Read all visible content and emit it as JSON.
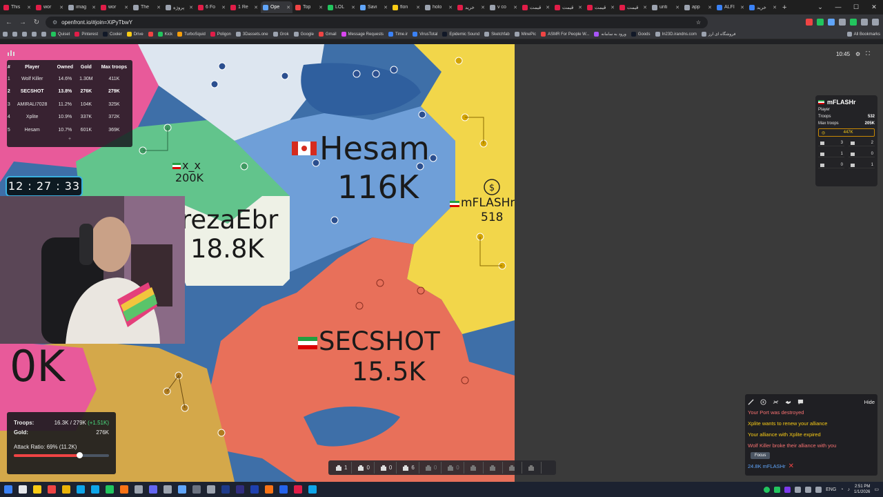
{
  "browser": {
    "tabs": [
      {
        "label": "This",
        "color": "#e11d48"
      },
      {
        "label": "wor",
        "color": "#e11d48"
      },
      {
        "label": "imag",
        "color": "#9ca3af"
      },
      {
        "label": "wor",
        "color": "#e11d48"
      },
      {
        "label": "The",
        "color": "#9ca3af"
      },
      {
        "label": "پروژه",
        "color": "#9ca3af"
      },
      {
        "label": "6 Fo",
        "color": "#e11d48"
      },
      {
        "label": "1 Re",
        "color": "#e11d48"
      },
      {
        "label": "Ope",
        "color": "#60a5fa",
        "active": true
      },
      {
        "label": "Top",
        "color": "#ef4444"
      },
      {
        "label": "LOL",
        "color": "#22c55e"
      },
      {
        "label": "Savi",
        "color": "#60a5fa"
      },
      {
        "label": "flon",
        "color": "#facc15"
      },
      {
        "label": "holo",
        "color": "#9ca3af"
      },
      {
        "label": "خرید",
        "color": "#e11d48"
      },
      {
        "label": "v co",
        "color": "#9ca3af"
      },
      {
        "label": "قیمت",
        "color": "#e11d48"
      },
      {
        "label": "قیمت",
        "color": "#e11d48"
      },
      {
        "label": "قیمت",
        "color": "#e11d48"
      },
      {
        "label": "قیمت",
        "color": "#e11d48"
      },
      {
        "label": "unti",
        "color": "#9ca3af"
      },
      {
        "label": "app",
        "color": "#9ca3af"
      },
      {
        "label": "ALFI",
        "color": "#3b82f6"
      },
      {
        "label": "خرید",
        "color": "#3b82f6"
      }
    ],
    "url": "openfront.io/#join=XiPyTbwY",
    "bookmarks": [
      {
        "label": "",
        "color": "#9ca3af"
      },
      {
        "label": "",
        "color": "#9ca3af"
      },
      {
        "label": "",
        "color": "#9ca3af"
      },
      {
        "label": "",
        "color": "#9ca3af"
      },
      {
        "label": "",
        "color": "#9ca3af"
      },
      {
        "label": "Quiset",
        "color": "#22c55e"
      },
      {
        "label": "Pinterest",
        "color": "#e11d48"
      },
      {
        "label": "Cooler",
        "color": "#111827"
      },
      {
        "label": "Drive",
        "color": "#facc15"
      },
      {
        "label": "",
        "color": "#ef4444"
      },
      {
        "label": "Kick",
        "color": "#22c55e"
      },
      {
        "label": "TurboSquid",
        "color": "#f59e0b"
      },
      {
        "label": "Poligon",
        "color": "#e11d48"
      },
      {
        "label": "3Dassets.one",
        "color": "#9ca3af"
      },
      {
        "label": "Grok",
        "color": "#9ca3af"
      },
      {
        "label": "Google",
        "color": "#9ca3af"
      },
      {
        "label": "Gmail",
        "color": "#ef4444"
      },
      {
        "label": "Message Requests",
        "color": "#d946ef"
      },
      {
        "label": "Time.ir",
        "color": "#3b82f6"
      },
      {
        "label": "VirusTotal",
        "color": "#3b82f6"
      },
      {
        "label": "Epidemic Sound",
        "color": "#111827"
      },
      {
        "label": "Sketchfab",
        "color": "#9ca3af"
      },
      {
        "label": "MinePic",
        "color": "#9ca3af"
      },
      {
        "label": "ASMR For People W...",
        "color": "#ef4444"
      },
      {
        "label": "ورود به سامانه",
        "color": "#a855f7"
      },
      {
        "label": "Goods",
        "color": "#111827"
      },
      {
        "label": "In23D.irandns.com",
        "color": "#9ca3af"
      },
      {
        "label": "فروشگاه ای ارز",
        "color": "#9ca3af"
      }
    ],
    "all_bookmarks": "All Bookmarks"
  },
  "leaderboard": {
    "headers": [
      "#",
      "Player",
      "Owned",
      "Gold",
      "Max troops"
    ],
    "rows": [
      {
        "rank": "1",
        "player": "Wolf Killer",
        "owned": "14.6%",
        "gold": "1.30M",
        "max": "411K"
      },
      {
        "rank": "2",
        "player": "SECSHOT",
        "owned": "13.8%",
        "gold": "276K",
        "max": "279K",
        "me": true
      },
      {
        "rank": "3",
        "player": "AMIRALI7028",
        "owned": "11.2%",
        "gold": "104K",
        "max": "325K"
      },
      {
        "rank": "4",
        "player": "Xplite",
        "owned": "10.9%",
        "gold": "337K",
        "max": "372K"
      },
      {
        "rank": "5",
        "player": "Hesam",
        "owned": "10.7%",
        "gold": "601K",
        "max": "369K"
      }
    ],
    "expand": "+"
  },
  "timer": "12 : 27 : 33",
  "map_labels": {
    "hesam_name": "Hesam",
    "hesam_troops": "116K",
    "secshot_name": "SECSHOT",
    "secshot_troops": "15.5K",
    "reza_name": "rezaEbr",
    "reza_troops": "18.8K",
    "xx_name": "x_x",
    "xx_troops": "200K",
    "mflash_name": "mFLASHr",
    "mflash_troops": "518",
    "left_troops": "0K"
  },
  "player_stats": {
    "troops_label": "Troops:",
    "troops_value": "16.3K / 279K",
    "troops_gain": "(+1.51K)",
    "gold_label": "Gold:",
    "gold_value": "276K",
    "ratio_label": "Attack Ratio: 69% (11.2K)",
    "ratio": 0.69
  },
  "buildbar": [
    {
      "icon": "city-icon",
      "count": "1",
      "dim": false
    },
    {
      "icon": "factory-icon",
      "count": "0",
      "dim": false
    },
    {
      "icon": "port-icon",
      "count": "0",
      "dim": false
    },
    {
      "icon": "defense-post-icon",
      "count": "6",
      "dim": false
    },
    {
      "icon": "missile-silo-icon",
      "count": "0",
      "dim": true
    },
    {
      "icon": "sam-launcher-icon",
      "count": "0",
      "dim": true
    },
    {
      "icon": "warship-icon",
      "count": "",
      "dim": true
    },
    {
      "icon": "atom-bomb-icon",
      "count": "",
      "dim": true
    },
    {
      "icon": "hydrogen-bomb-icon",
      "count": "",
      "dim": true
    },
    {
      "icon": "mirv-icon",
      "count": "",
      "dim": true
    }
  ],
  "topright": {
    "time": "10:45"
  },
  "player_card": {
    "name": "mFLASHr",
    "type": "Player",
    "troops_label": "Troops",
    "troops": "532",
    "max_label": "Max troops",
    "max": "205K",
    "gold": "447K",
    "stats": [
      {
        "icon": "city-icon",
        "value": "3"
      },
      {
        "icon": "factory-icon",
        "value": "2"
      },
      {
        "icon": "port-icon",
        "value": "1"
      },
      {
        "icon": "missile-silo-icon",
        "value": "0"
      },
      {
        "icon": "sam-launcher-icon",
        "value": "0"
      },
      {
        "icon": "warship-icon",
        "value": "1"
      }
    ]
  },
  "events": {
    "hide": "Hide",
    "items": [
      {
        "text": "Your Port was destroyed",
        "color": "red"
      },
      {
        "text": "Xplite wants to renew your alliance",
        "color": "yellow"
      },
      {
        "text": "Your alliance with Xplite expired",
        "color": "yellow"
      },
      {
        "text": "Wolf Killer broke their alliance with you",
        "color": "red"
      }
    ],
    "focus": "Focus",
    "incoming": "24.8K mFLASHr"
  },
  "taskbar": {
    "lang": "ENG",
    "time": "2:51 PM",
    "date": "1/1/2026"
  },
  "colors": {
    "hesam": "#6f9fd8",
    "secshot": "#e8705a",
    "mflash": "#f2d64a",
    "xx": "#62c48c",
    "reza": "#eef1e6",
    "ocean": "#3e6fa8",
    "left_player": "#d4a84a",
    "pink": "#e85a9a"
  }
}
